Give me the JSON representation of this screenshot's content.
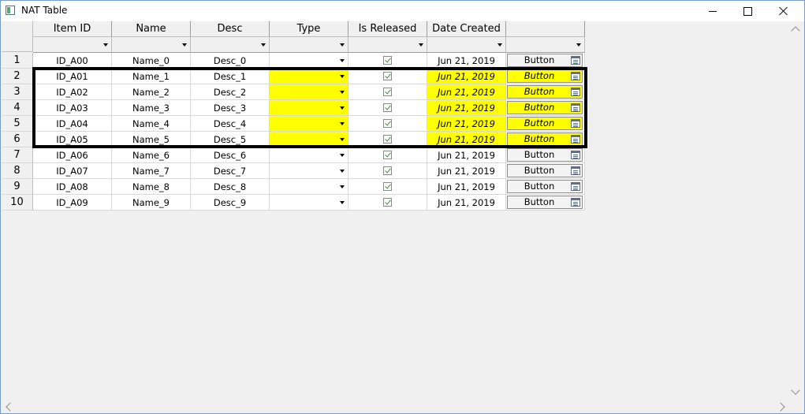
{
  "window": {
    "title": "NAT Table",
    "icon": "table-window-icon"
  },
  "columns": [
    "Item ID",
    "Name",
    "Desc",
    "Type",
    "Is Released",
    "Date Created",
    ""
  ],
  "rows": [
    {
      "num": "1",
      "id": "ID_A00",
      "name": "Name_0",
      "desc": "Desc_0",
      "released": true,
      "date": "Jun 21, 2019",
      "button": "Button",
      "selected": false
    },
    {
      "num": "2",
      "id": "ID_A01",
      "name": "Name_1",
      "desc": "Desc_1",
      "released": true,
      "date": "Jun 21, 2019",
      "button": "Button",
      "selected": true
    },
    {
      "num": "3",
      "id": "ID_A02",
      "name": "Name_2",
      "desc": "Desc_2",
      "released": true,
      "date": "Jun 21, 2019",
      "button": "Button",
      "selected": true
    },
    {
      "num": "4",
      "id": "ID_A03",
      "name": "Name_3",
      "desc": "Desc_3",
      "released": true,
      "date": "Jun 21, 2019",
      "button": "Button",
      "selected": true
    },
    {
      "num": "5",
      "id": "ID_A04",
      "name": "Name_4",
      "desc": "Desc_4",
      "released": true,
      "date": "Jun 21, 2019",
      "button": "Button",
      "selected": true
    },
    {
      "num": "6",
      "id": "ID_A05",
      "name": "Name_5",
      "desc": "Desc_5",
      "released": true,
      "date": "Jun 21, 2019",
      "button": "Button",
      "selected": true
    },
    {
      "num": "7",
      "id": "ID_A06",
      "name": "Name_6",
      "desc": "Desc_6",
      "released": true,
      "date": "Jun 21, 2019",
      "button": "Button",
      "selected": false
    },
    {
      "num": "8",
      "id": "ID_A07",
      "name": "Name_7",
      "desc": "Desc_7",
      "released": true,
      "date": "Jun 21, 2019",
      "button": "Button",
      "selected": false
    },
    {
      "num": "9",
      "id": "ID_A08",
      "name": "Name_8",
      "desc": "Desc_8",
      "released": true,
      "date": "Jun 21, 2019",
      "button": "Button",
      "selected": false
    },
    {
      "num": "10",
      "id": "ID_A09",
      "name": "Name_9",
      "desc": "Desc_9",
      "released": true,
      "date": "Jun 21, 2019",
      "button": "Button",
      "selected": false
    }
  ],
  "colors": {
    "selection_fill": "#ffff00",
    "selection_border": "#000000",
    "checkbox_check": "#3a8a3a"
  }
}
